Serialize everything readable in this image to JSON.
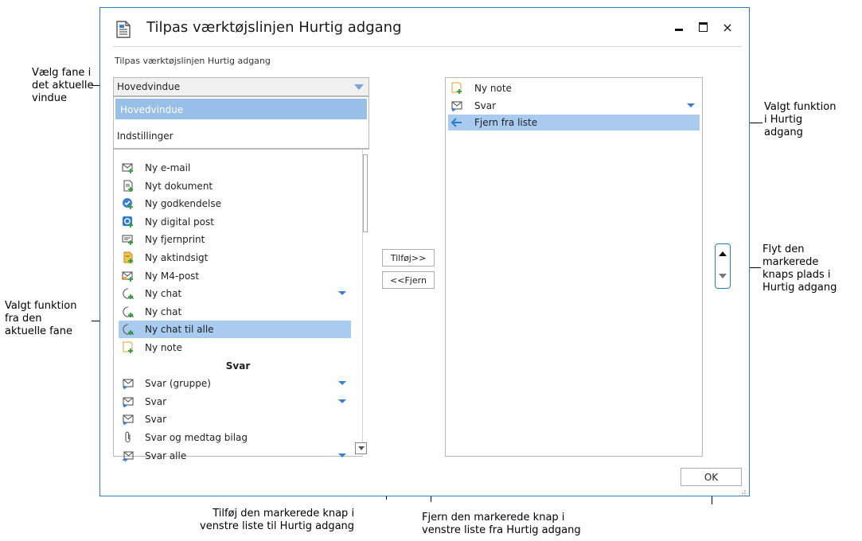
{
  "dialog": {
    "title": "Tilpas værktøjslinjen Hurtig adgang",
    "subtitle": "Tilpas værktøjslinjen Hurtig adgang",
    "minimize_glyph": "−",
    "maximize_glyph": "□",
    "close_glyph": "×"
  },
  "combo": {
    "value": "Hovedvindue",
    "options": [
      "Hovedvindue",
      "Indstillinger"
    ]
  },
  "left_list": [
    {
      "label": "Ny e-mail",
      "icon": "new-email-icon"
    },
    {
      "label": "Nyt dokument",
      "icon": "new-document-icon"
    },
    {
      "label": "Ny godkendelse",
      "icon": "new-approval-icon"
    },
    {
      "label": "Ny digital post",
      "icon": "new-digital-post-icon"
    },
    {
      "label": "Ny fjernprint",
      "icon": "new-remote-print-icon"
    },
    {
      "label": "Ny aktindsigt",
      "icon": "new-access-request-icon"
    },
    {
      "label": "Ny M4-post",
      "icon": "new-m4-post-icon"
    },
    {
      "label": "Ny chat",
      "icon": "new-chat-icon",
      "dropdown": true
    },
    {
      "label": "Ny chat",
      "icon": "new-chat-icon"
    },
    {
      "label": "Ny chat til alle",
      "icon": "new-chat-all-icon",
      "selected": true
    },
    {
      "label": "Ny note",
      "icon": "new-note-icon"
    },
    {
      "label": "Svar",
      "header": true
    },
    {
      "label": "Svar (gruppe)",
      "icon": "reply-group-icon",
      "dropdown": true
    },
    {
      "label": "Svar",
      "icon": "reply-icon",
      "dropdown": true
    },
    {
      "label": "Svar",
      "icon": "reply-icon"
    },
    {
      "label": "Svar og medtag bilag",
      "icon": "paperclip-icon"
    },
    {
      "label": "Svar alle",
      "icon": "reply-all-icon",
      "dropdown": true
    }
  ],
  "buttons": {
    "add": "Tilføj>>",
    "remove": "<<Fjern",
    "ok": "OK"
  },
  "right_list": [
    {
      "label": "Ny note",
      "icon": "new-note-icon"
    },
    {
      "label": "Svar",
      "icon": "reply-icon",
      "dropdown": true
    },
    {
      "label": "Fjern fra liste",
      "icon": "arrow-left-icon",
      "selected": true
    }
  ],
  "annotations": {
    "choose_tab": [
      "Vælg fane i",
      "det aktuelle",
      "vindue"
    ],
    "selected_left": [
      "Valgt funktion",
      "fra den",
      "aktuelle fane"
    ],
    "selected_right": [
      "Valgt funktion",
      "i Hurtig",
      "adgang"
    ],
    "move": [
      "Flyt den",
      "markerede",
      "knaps plads i",
      "Hurtig adgang"
    ],
    "add_desc": [
      "Tilføj den markerede knap i",
      "venstre liste til Hurtig adgang"
    ],
    "remove_desc": [
      "Fjern den markerede knap i",
      "venstre liste fra Hurtig adgang"
    ]
  },
  "colors": {
    "accent": "#2b7bc9",
    "selection": "#a9cbef",
    "dropdown_arrow": "#3a7fd0"
  }
}
